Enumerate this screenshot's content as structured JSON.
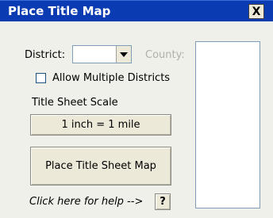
{
  "window": {
    "title": "Place Title Map",
    "close_glyph": "X"
  },
  "district": {
    "label": "District:",
    "selected_value": ""
  },
  "county": {
    "label": "County:"
  },
  "allow_multiple": {
    "label": "Allow Multiple Districts",
    "checked": false
  },
  "scale": {
    "heading": "Title Sheet Scale",
    "button_label": "1 inch = 1 mile"
  },
  "place_button": {
    "label": "Place Title Sheet Map"
  },
  "help": {
    "text": "Click here for help -->",
    "button_label": "?"
  },
  "colors": {
    "title_bar": "#0b3bb3",
    "dialog_background": "#f0f0ea",
    "disabled_text": "#b0b0a8"
  }
}
